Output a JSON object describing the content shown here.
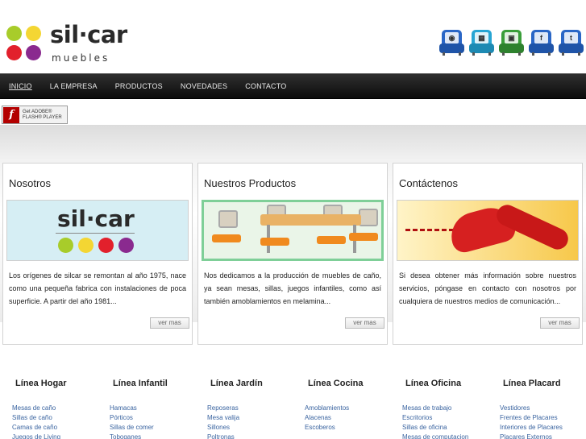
{
  "brand": {
    "name": "sil·car",
    "tagline": "muebles",
    "dot_colors": [
      "#a8cc2a",
      "#f4d633",
      "#e2202c",
      "#8a2a8f"
    ]
  },
  "social_icons": [
    {
      "name": "chair-icon-1",
      "color": "#2a66c6",
      "glyph": "◉"
    },
    {
      "name": "chair-icon-2",
      "color": "#27a5d3",
      "glyph": "▦"
    },
    {
      "name": "chair-icon-3",
      "color": "#3a9e3a",
      "glyph": "▣"
    },
    {
      "name": "chair-icon-4",
      "color": "#2a66c6",
      "glyph": "f"
    },
    {
      "name": "chair-icon-5",
      "color": "#2a66c6",
      "glyph": "t"
    }
  ],
  "nav": {
    "items": [
      "INICIO",
      "LA EMPRESA",
      "PRODUCTOS",
      "NOVEDADES",
      "CONTACTO"
    ],
    "active": "INICIO"
  },
  "flash_badge": {
    "line1": "Get ADOBE®",
    "line2": "FLASH® PLAYER"
  },
  "boxes": [
    {
      "title": "Nosotros",
      "text": "Los orígenes de silcar se remontan al año 1975, nace como una pequeña fabrica con instalaciones de poca superficie. A partir del año 1981...",
      "more": "ver mas",
      "image_text": "sil·car"
    },
    {
      "title": "Nuestros Productos",
      "text": "Nos dedicamos a la producción de muebles de caño, ya sean mesas, sillas, juegos infantiles, como así también amoblamientos en melamina...",
      "more": "ver mas"
    },
    {
      "title": "Contáctenos",
      "text": "Si desea obtener más información sobre nuestros servicios, póngase en contacto con nosotros por cualquiera de nuestros medios de comunicación...",
      "more": "ver mas"
    }
  ],
  "categories": [
    {
      "title": "Línea Hogar",
      "items": [
        "Mesas de caño",
        "Sillas de caño",
        "Camas de caño",
        "Juegos de Living"
      ]
    },
    {
      "title": "Línea Infantil",
      "items": [
        "Hamacas",
        "Pórticos",
        "Sillas de comer",
        "Toboganes"
      ]
    },
    {
      "title": "Línea Jardín",
      "items": [
        "Reposeras",
        "Mesa valija",
        "Sillones",
        "Poltronas"
      ]
    },
    {
      "title": "Línea Cocina",
      "items": [
        "Amoblamientos",
        "Alacenas",
        "Escoberos"
      ]
    },
    {
      "title": "Línea Oficina",
      "items": [
        "Mesas de trabajo",
        "Escritorios",
        "Sillas de oficina",
        "Mesas de computacion"
      ]
    },
    {
      "title": "Línea Placard",
      "items": [
        "Vestidores",
        "Frentes de Placares",
        "Interiores de Placares",
        "Placares Externos"
      ]
    }
  ]
}
